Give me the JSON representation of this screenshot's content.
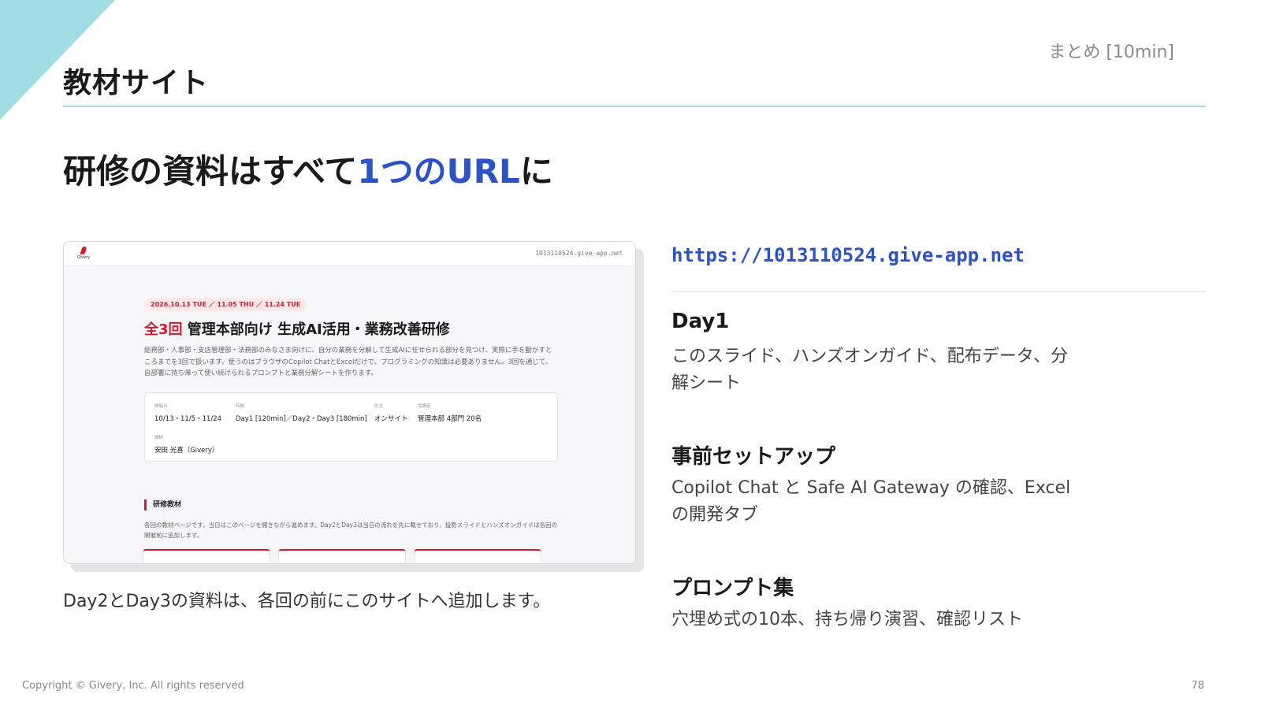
{
  "slide": {
    "section_title": "教材サイト",
    "section_tag": "まとめ [10min]",
    "headline_pre": "研修の資料はすべて",
    "headline_highlight": "1つのURL",
    "headline_post": "に",
    "caption": "Day2とDay3の資料は、各回の前にこのサイトへ追加します。",
    "copyright": "Copyright © Givery, Inc. All rights reserved",
    "page_number": "78"
  },
  "colors": {
    "accent_blue": "#2c52c8",
    "accent_cyan": "#a2dce5",
    "brand_red": "#d41b2b"
  },
  "embedded_site": {
    "logo_text": "Givery",
    "url": "1013110524.give-app.net",
    "date_pill": "2026.10.13 TUE ／ 11.05 THU ／ 11.24 TUE",
    "title_red": "全3回",
    "title_rest": " 管理本部向け 生成AI活用・業務改善研修",
    "description": "総務部・人事部・支店管理部・法務部のみなさま向けに、自分の業務を分解して生成AIに任せられる部分を見つけ、実際に手を動かすところまでを3回で扱います。使うのはブラウザのCopilot ChatとExcelだけで、プログラミングの知識は必要ありません。3回を通じて、自部署に持ち帰って使い続けられるプロンプトと業務分解シートを作ります。",
    "info": {
      "date_label": "開催日",
      "date_value": "10/13・11/5・11/24",
      "time_label": "時間",
      "time_value": "Day1 [120min]／Day2・Day3 [180min]",
      "format_label": "形式",
      "format_value": "オンサイト",
      "audience_label": "受講者",
      "audience_value": "管理本部 4部門 20名",
      "lecturer_label": "講師",
      "lecturer_value": "安田 光喜（Givery）"
    },
    "materials_heading": "研修教材",
    "materials_note": "各回の教材ページです。当日はこのページを開きながら進めます。Day2とDay3は当日の流れを先に載せており、投影スライドとハンズオンガイドは各回の開催前に追加します。"
  },
  "right_panel": {
    "url": "https://1013110524.give-app.net",
    "items": [
      {
        "title": "Day1",
        "text": "このスライド、ハンズオンガイド、配布データ、分解シート"
      },
      {
        "title": "事前セットアップ",
        "text": "Copilot Chat と Safe AI Gateway の確認、Excel の開発タブ"
      },
      {
        "title": "プロンプト集",
        "text": "穴埋め式の10本、持ち帰り演習、確認リスト"
      }
    ]
  }
}
